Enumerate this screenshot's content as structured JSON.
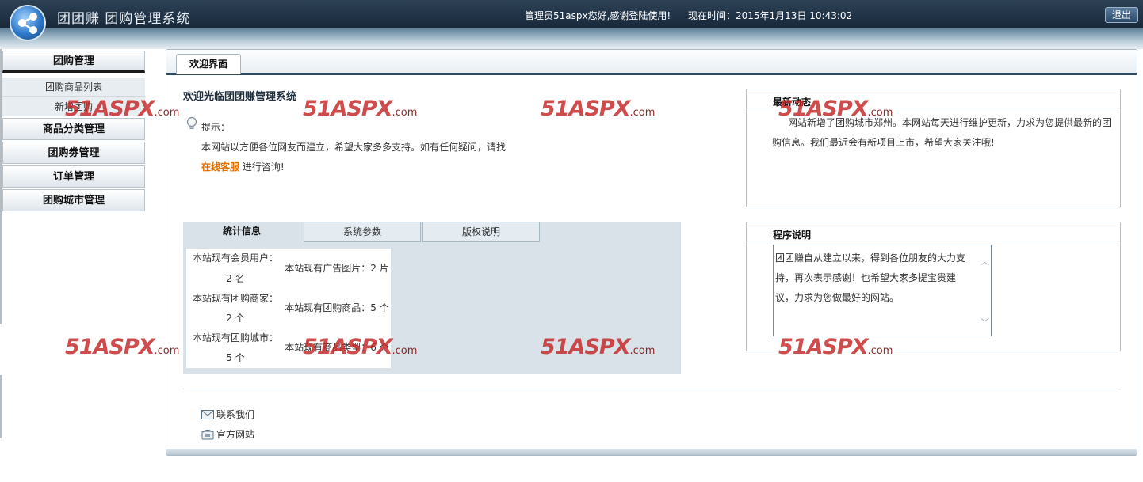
{
  "header": {
    "app_title": "团团赚  团购管理系统",
    "welcome": "管理员51aspx您好,感谢登陆使用!",
    "time_label": "现在时间：2015年1月13日 10:43:02",
    "logout_label": "退出"
  },
  "sidebar": {
    "groups": [
      {
        "label": "团购管理",
        "active": true,
        "items": [
          {
            "label": "团购商品列表"
          },
          {
            "label": "新增团购"
          }
        ]
      },
      {
        "label": "商品分类管理"
      },
      {
        "label": "团购劵管理"
      },
      {
        "label": "订单管理"
      },
      {
        "label": "团购城市管理"
      }
    ]
  },
  "main": {
    "tab_label": "欢迎界面",
    "title": "欢迎光临团团赚管理系统",
    "tip_label": "提示：",
    "tip_text": "本网站以方便各位网友而建立，希望大家多多支持。如有任何疑问，请找",
    "service_link": "在线客服",
    "tip_suffix": " 进行咨询!",
    "stats": {
      "tabs": [
        "统计信息",
        "系统参数",
        "版权说明"
      ],
      "active_tab": 0,
      "rows": [
        {
          "l1": "本站现有会员用户：",
          "l2": "2 名",
          "r": "本站现有广告图片：2 片"
        },
        {
          "l1": "本站现有团购商家：",
          "l2": "2 个",
          "r": "本站现有团购商品：5 个"
        },
        {
          "l1": "本站现有团购城市：",
          "l2": "5 个",
          "r": "本站现有商品类型：6 个"
        }
      ]
    },
    "news": {
      "title": "最新动态",
      "text": "网站新增了团购城市郑州。本网站每天进行维护更新，力求为您提供最新的团购信息。我们最近会有新项目上市，希望大家关注哦!"
    },
    "program": {
      "title": "程序说明",
      "text": "团团赚自从建立以来，得到各位朋友的大力支持，再次表示感谢！也希望大家多提宝贵建议，力求为您做最好的网站。"
    },
    "footer": {
      "contact": "联系我们",
      "official": "官方网站"
    }
  },
  "watermark": {
    "text": "51ASPX",
    "domain": ".com",
    "color": "#c42424"
  },
  "colors": {
    "header_dark": "#17283a",
    "accent_orange": "#e06f00",
    "border": "#aab8c4"
  }
}
